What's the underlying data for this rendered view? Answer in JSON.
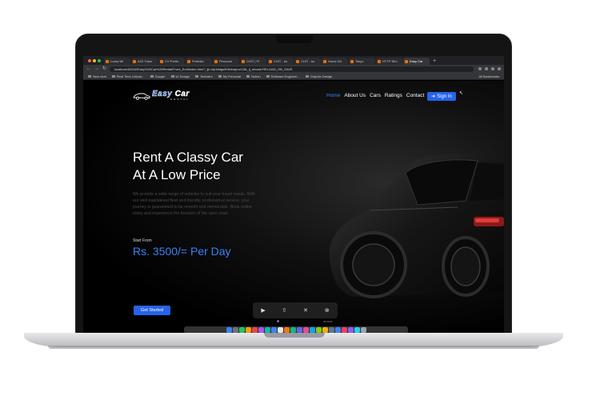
{
  "browser": {
    "tabs": [
      {
        "label": "Lucky Wi"
      },
      {
        "label": "A2Z Track"
      },
      {
        "label": "CV Portfo"
      },
      {
        "label": "Portfolio"
      },
      {
        "label": "Personal"
      },
      {
        "label": "CHIT | Pr"
      },
      {
        "label": "CHIT - bu"
      },
      {
        "label": "CHIT - bu"
      },
      {
        "label": "Home Dri"
      },
      {
        "label": "Tokyo"
      },
      {
        "label": "HTTP Stru"
      },
      {
        "label": "Easy Car"
      }
    ],
    "url": "localhost:63342/Easy%20Car%20Rental/Front_End/index.html?_ijt=nlp1fatgs0h5vkmpuv1l3&_ij_reload=RELOAD_ON_SAVE",
    "bookmarks": [
      "New chat",
      "Real Time Unicod...",
      "Google",
      "UI Design",
      "Techwire",
      "My Personal",
      "Notion",
      "Software Engineer...",
      "Graphic Design"
    ],
    "bookmarks_right": "All Bookmarks"
  },
  "site": {
    "logo": {
      "main_a": "Easy",
      "main_b": "Car",
      "sub": "RENTAL"
    },
    "nav": [
      "Home",
      "About Us",
      "Cars",
      "Ratings",
      "Contact"
    ],
    "signin": "Sign In",
    "hero": {
      "title_line1": "Rent A Classy Car",
      "title_line2": "At A Low Price",
      "description": "We provide a wide range of vehicles to suit your travel needs. With our well-maintained fleet and friendly, professional service, your journey is guaranteed to be smooth and memorable. Book online today and experience the freedom of the open road.",
      "start_from": "Start From",
      "price": "Rs. 3500/= Per Day",
      "cta": "Get Started"
    }
  },
  "player": {
    "play_icon": "play-icon",
    "share_icon": "share-icon",
    "close_icon": "close-icon",
    "time": "00:00:00"
  },
  "colors": {
    "accent": "#2563eb",
    "accent_text": "#3b82f6",
    "background": "#000000"
  }
}
